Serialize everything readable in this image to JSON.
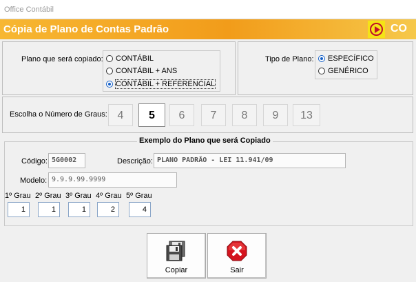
{
  "window": {
    "title": "Office Contábil"
  },
  "banner": {
    "title": "Cópia de Plano de Contas Padrão",
    "logo_text": "CO",
    "play_icon": "play-circle-icon"
  },
  "plano": {
    "label": "Plano que será copiado:",
    "options": [
      {
        "label": "CONTÁBIL",
        "selected": false
      },
      {
        "label": "CONTÁBIL + ANS",
        "selected": false
      },
      {
        "label": "CONTÁBIL + REFERENCIAL",
        "selected": true
      }
    ]
  },
  "tipo": {
    "label": "Tipo de Plano:",
    "options": [
      {
        "label": "ESPECÍFICO",
        "selected": true
      },
      {
        "label": "GENÉRICO",
        "selected": false
      }
    ]
  },
  "graus": {
    "label": "Escolha o Número de Graus:",
    "options": [
      "4",
      "5",
      "6",
      "7",
      "8",
      "9",
      "13"
    ],
    "selected": "5"
  },
  "exemplo": {
    "legend": "Exemplo do Plano que será Copiado",
    "codigo_label": "Código:",
    "codigo_value": "5G0002",
    "descricao_label": "Descrição:",
    "descricao_value": "PLANO PADRÃO - LEI 11.941/09",
    "modelo_label": "Modelo:",
    "modelo_value": "9.9.9.99.9999",
    "graus": [
      {
        "label": "1º Grau",
        "value": "1"
      },
      {
        "label": "2º Grau",
        "value": "1"
      },
      {
        "label": "3º Grau",
        "value": "1"
      },
      {
        "label": "4º Grau",
        "value": "2"
      },
      {
        "label": "5º Grau",
        "value": "4"
      }
    ]
  },
  "buttons": {
    "copiar": "Copiar",
    "sair": "Sair"
  },
  "colors": {
    "banner": "#f29c1a",
    "accent": "#c0102a",
    "radio": "#1560c8"
  }
}
